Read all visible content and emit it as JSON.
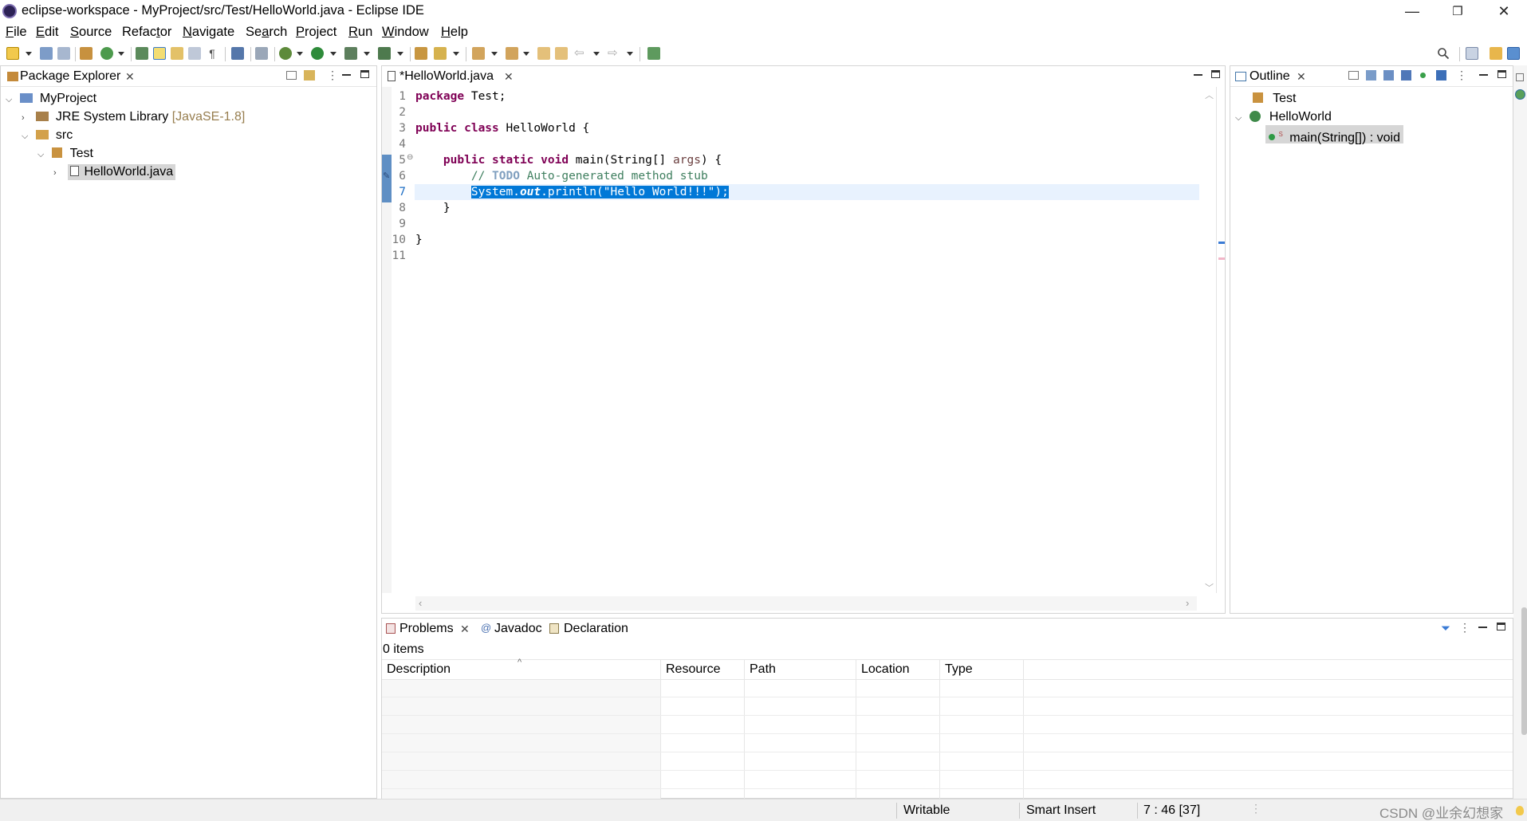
{
  "window": {
    "title": "eclipse-workspace - MyProject/src/Test/HelloWorld.java - Eclipse IDE",
    "minimize": "—",
    "restore": "❐",
    "close": "✕"
  },
  "menu": [
    {
      "u": "F",
      "rest": "ile"
    },
    {
      "u": "E",
      "rest": "dit"
    },
    {
      "u": "S",
      "rest": "ource"
    },
    {
      "u": "",
      "rest": "Refac",
      "u2": "t",
      "rest2": "or"
    },
    {
      "u": "N",
      "rest": "avigate"
    },
    {
      "u": "",
      "rest": "Se",
      "u2": "a",
      "rest2": "rch"
    },
    {
      "u": "P",
      "rest": "roject"
    },
    {
      "u": "R",
      "rest": "un"
    },
    {
      "u": "W",
      "rest": "indow"
    },
    {
      "u": "H",
      "rest": "elp"
    }
  ],
  "package_explorer": {
    "tab_label": "Package Explorer",
    "tree": {
      "project": "MyProject",
      "jre": "JRE System Library",
      "jre_version": "[JavaSE-1.8]",
      "src": "src",
      "package": "Test",
      "file": "HelloWorld.java"
    }
  },
  "editor": {
    "tab_label": "*HelloWorld.java",
    "line_numbers": [
      "1",
      "2",
      "3",
      "4",
      "5",
      "6",
      "7",
      "8",
      "9",
      "10",
      "11"
    ],
    "lines": {
      "l1_kw": "package",
      "l1_rest": " Test;",
      "l3_kw": "public class",
      "l3_rest": " HelloWorld {",
      "l5_indent": "    ",
      "l5_kw": "public static void",
      "l5_rest": " main(String[] ",
      "l5_args": "args",
      "l5_end": ") {",
      "l6_indent": "        ",
      "l6_comment": "// ",
      "l6_todo": "TODO",
      "l6_comment_rest": " Auto-generated method stub",
      "l7_indent": "        ",
      "l7_system": "System.",
      "l7_out": "out",
      "l7_println": ".println(",
      "l7_string": "\"Hello World!!!\"",
      "l7_end": ");",
      "l8": "    }",
      "l10": "}"
    },
    "fold_marker": "⊖"
  },
  "outline": {
    "tab_label": "Outline",
    "items": {
      "package": "Test",
      "class": "HelloWorld",
      "method": "main(String[]) : void",
      "method_modifier": "S"
    }
  },
  "bottom": {
    "tabs": {
      "problems": "Problems",
      "javadoc": "Javadoc",
      "declaration": "Declaration"
    },
    "items_count": "0 items",
    "columns": [
      "Description",
      "Resource",
      "Path",
      "Location",
      "Type"
    ],
    "sort_arrow": "^"
  },
  "status": {
    "writable": "Writable",
    "insert_mode": "Smart Insert",
    "position": "7 : 46 [37]",
    "watermark": "CSDN @业余幻想家"
  },
  "colors": {
    "keyword": "#7f0055",
    "comment": "#3f7f5f",
    "string": "#2a00ff",
    "selection": "#0078d7"
  }
}
